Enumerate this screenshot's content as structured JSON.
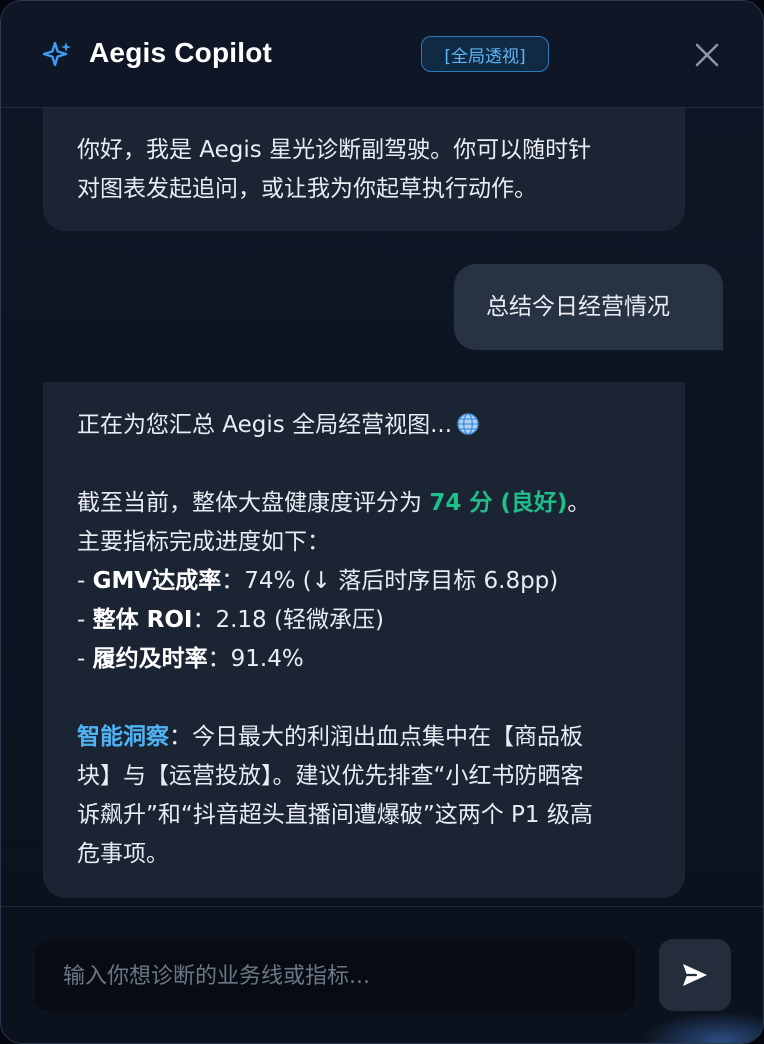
{
  "header": {
    "app_title": "Aegis Copilot",
    "mode_badge": "[全局透视]",
    "spark_icon": "sparkle-icon",
    "close_icon": "close-icon",
    "accent_color": "#3b9bf0"
  },
  "messages": [
    {
      "role": "assistant",
      "lines": [
        "你好，我是 Aegis 星光诊断副驾驶。你可以随时针",
        "对图表发起追问，或让我为你起草执行动作。"
      ]
    },
    {
      "role": "user",
      "text": "总结今日经营情况"
    },
    {
      "role": "assistant",
      "intro": "正在为您汇总 Aegis 全局经营视图...",
      "intro_icon": "globe-icon",
      "score_prefix": "截至当前，整体大盘健康度评分为 ",
      "score_value": "74 分 (良好)",
      "score_suffix": "。",
      "metrics_title": "主要指标完成进度如下：",
      "metrics": [
        {
          "bullet": "- ",
          "label": "GMV达成率",
          "value": "：74% (↓ 落后时序目标 6.8pp)"
        },
        {
          "bullet": "- ",
          "label": "整体 ROI",
          "value": "：2.18 (轻微承压)"
        },
        {
          "bullet": "- ",
          "label": "履约及时率",
          "value": "：91.4%"
        }
      ],
      "insight_label": "智能洞察",
      "insight_lines": [
        "：今日最大的利润出血点集中在【商品板",
        "块】与【运营投放】。建议优先排查“小红书防晒客",
        "诉飙升”和“抖音超头直播间遭爆破”这两个 P1 级高",
        "危事项。"
      ],
      "score_color": "#1fbf8a",
      "insight_color": "#4fb3f3"
    }
  ],
  "composer": {
    "placeholder": "输入你想诊断的业务线或指标...",
    "send_icon": "send-icon"
  }
}
